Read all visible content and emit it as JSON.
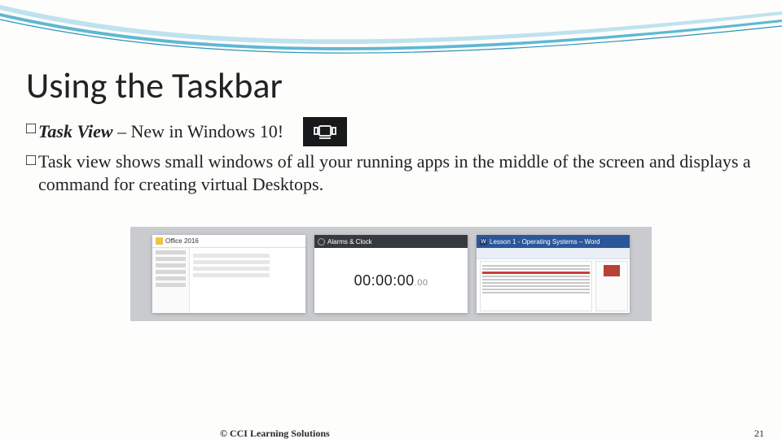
{
  "title": "Using the Taskbar",
  "bullets": {
    "b1_bold": "Task View",
    "b1_rest": " – New in Windows 10!",
    "b2": "Task view shows small windows of all your running apps in the middle of the screen and displays a command for creating virtual Desktops."
  },
  "taskview_icon": "task-view-icon",
  "preview": {
    "thumb1": {
      "title": "Office 2016"
    },
    "thumb2": {
      "title": "Alarms & Clock",
      "time_main": "00:00:00",
      "time_cent": ".00"
    },
    "thumb3": {
      "title": "Lesson 1 - Operating Systems – Word",
      "word_mark": "W"
    }
  },
  "footer": {
    "copyright": "© CCI Learning Solutions",
    "page": "21"
  }
}
